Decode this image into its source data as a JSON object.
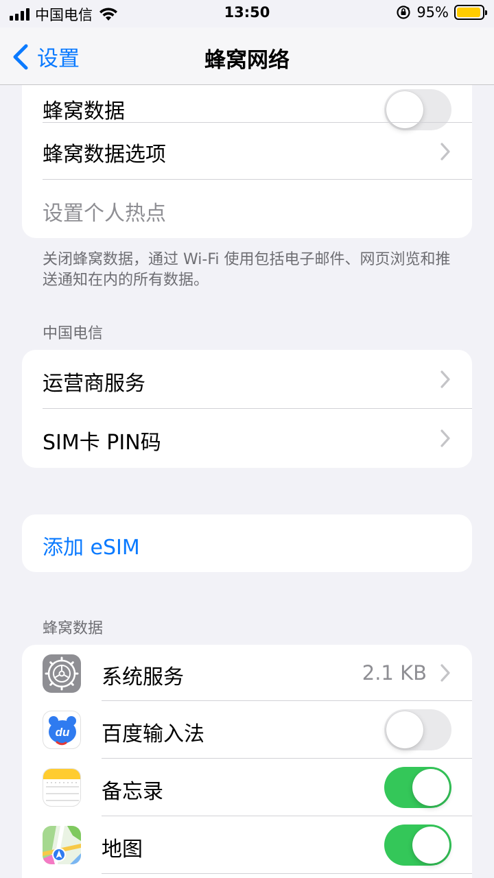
{
  "status_bar": {
    "carrier": "中国电信",
    "time": "13:50",
    "battery_percent": "95%",
    "battery_level": 0.95,
    "battery_color": "#ffcc00"
  },
  "nav": {
    "back_label": "设置",
    "title": "蜂窝网络"
  },
  "group1": {
    "cellular_data_label": "蜂窝数据",
    "cellular_data_on": false,
    "options_label": "蜂窝数据选项",
    "hotspot_label": "设置个人热点"
  },
  "footnote": "关闭蜂窝数据，通过 Wi-Fi 使用包括电子邮件、网页浏览和推送通知在内的所有数据。",
  "carrier_section": {
    "header": "中国电信",
    "carrier_services": "运营商服务",
    "sim_pin": "SIM卡 PIN码"
  },
  "esim": {
    "add_label": "添加 eSIM"
  },
  "apps_section": {
    "header": "蜂窝数据",
    "apps": [
      {
        "name": "系统服务",
        "value": "2.1 KB",
        "icon": "gear-icon"
      },
      {
        "name": "百度输入法",
        "enabled": false,
        "icon": "baidu-input-icon"
      },
      {
        "name": "备忘录",
        "enabled": true,
        "icon": "notes-icon"
      },
      {
        "name": "地图",
        "enabled": true,
        "icon": "maps-icon"
      }
    ]
  },
  "colors": {
    "accent": "#0a7aff",
    "switch_on": "#34c759",
    "background": "#f2f2f7"
  }
}
